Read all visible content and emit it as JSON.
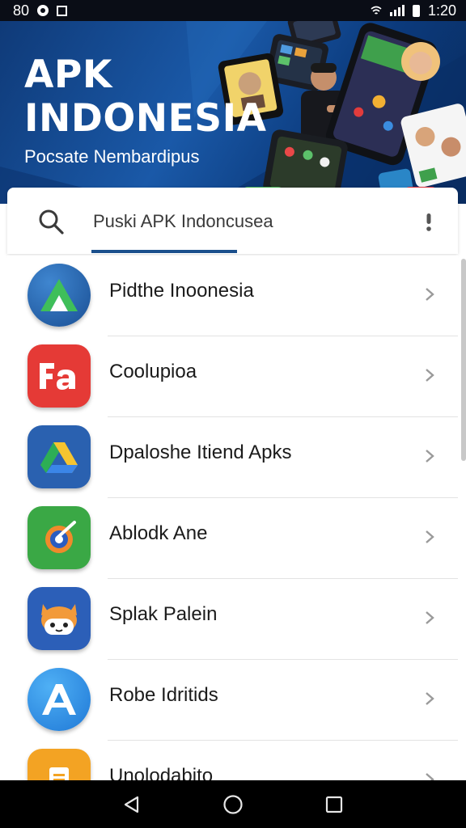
{
  "status_bar": {
    "left_text": "80",
    "time": "1:20"
  },
  "banner": {
    "title_line1": "APK",
    "title_line2": "INDONESIA",
    "subtitle": "Pocsate Nembardipus"
  },
  "search": {
    "placeholder": "Puski APK Indoncusea",
    "icon": "search-icon",
    "menu_icon": "more-vert-icon"
  },
  "apps": [
    {
      "name": "Pidthe Inoonesia",
      "icon": "triangle-a-logo-icon",
      "color": "#1f5fa6"
    },
    {
      "name": "Coolupioa",
      "icon": "fa-letters-icon",
      "color": "#e53a36"
    },
    {
      "name": "Dpaloshe Itiend Apks",
      "icon": "drive-triangle-icon",
      "color": "#2a61b0"
    },
    {
      "name": "Ablodk Ane",
      "icon": "swirl-logo-icon",
      "color": "#3aa845"
    },
    {
      "name": "Splak Palein",
      "icon": "cat-mascot-icon",
      "color": "#2c5fb8"
    },
    {
      "name": "Robe Idritids",
      "icon": "letter-a-icon",
      "color": "#2e8fe0"
    },
    {
      "name": "Unolodabito",
      "icon": "document-icon",
      "color": "#f3a323"
    }
  ],
  "nav": {
    "back": "back-triangle-icon",
    "home": "home-circle-icon",
    "recents": "recents-square-icon"
  }
}
